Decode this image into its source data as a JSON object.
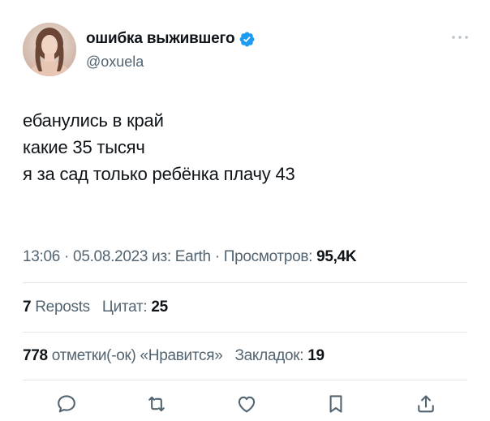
{
  "tweet": {
    "author": {
      "display_name": "ошибка выжившего",
      "handle": "@oxuela",
      "verified": true,
      "verified_color": "#1d9bf0"
    },
    "text_lines": [
      "ебанулись в край",
      "какие 35 тысяч",
      "",
      "я за сад только ребёнка плачу 43"
    ],
    "meta": {
      "time": "13:06",
      "separator": " · ",
      "date": "05.08.2023",
      "source_label": "из: Earth",
      "views_label": "Просмотров:",
      "views_count": "95,4K"
    },
    "stats_row_1": {
      "reposts_count": "7",
      "reposts_label": "Reposts",
      "quotes_label": "Цитат:",
      "quotes_count": "25"
    },
    "stats_row_2": {
      "likes_count": "778",
      "likes_label": "отметки(-ок) «Нравится»",
      "bookmarks_label": "Закладок:",
      "bookmarks_count": "19"
    },
    "actions": [
      "reply-icon",
      "retweet-icon",
      "like-icon",
      "bookmark-icon",
      "share-icon"
    ],
    "icon_color": "#536471"
  }
}
